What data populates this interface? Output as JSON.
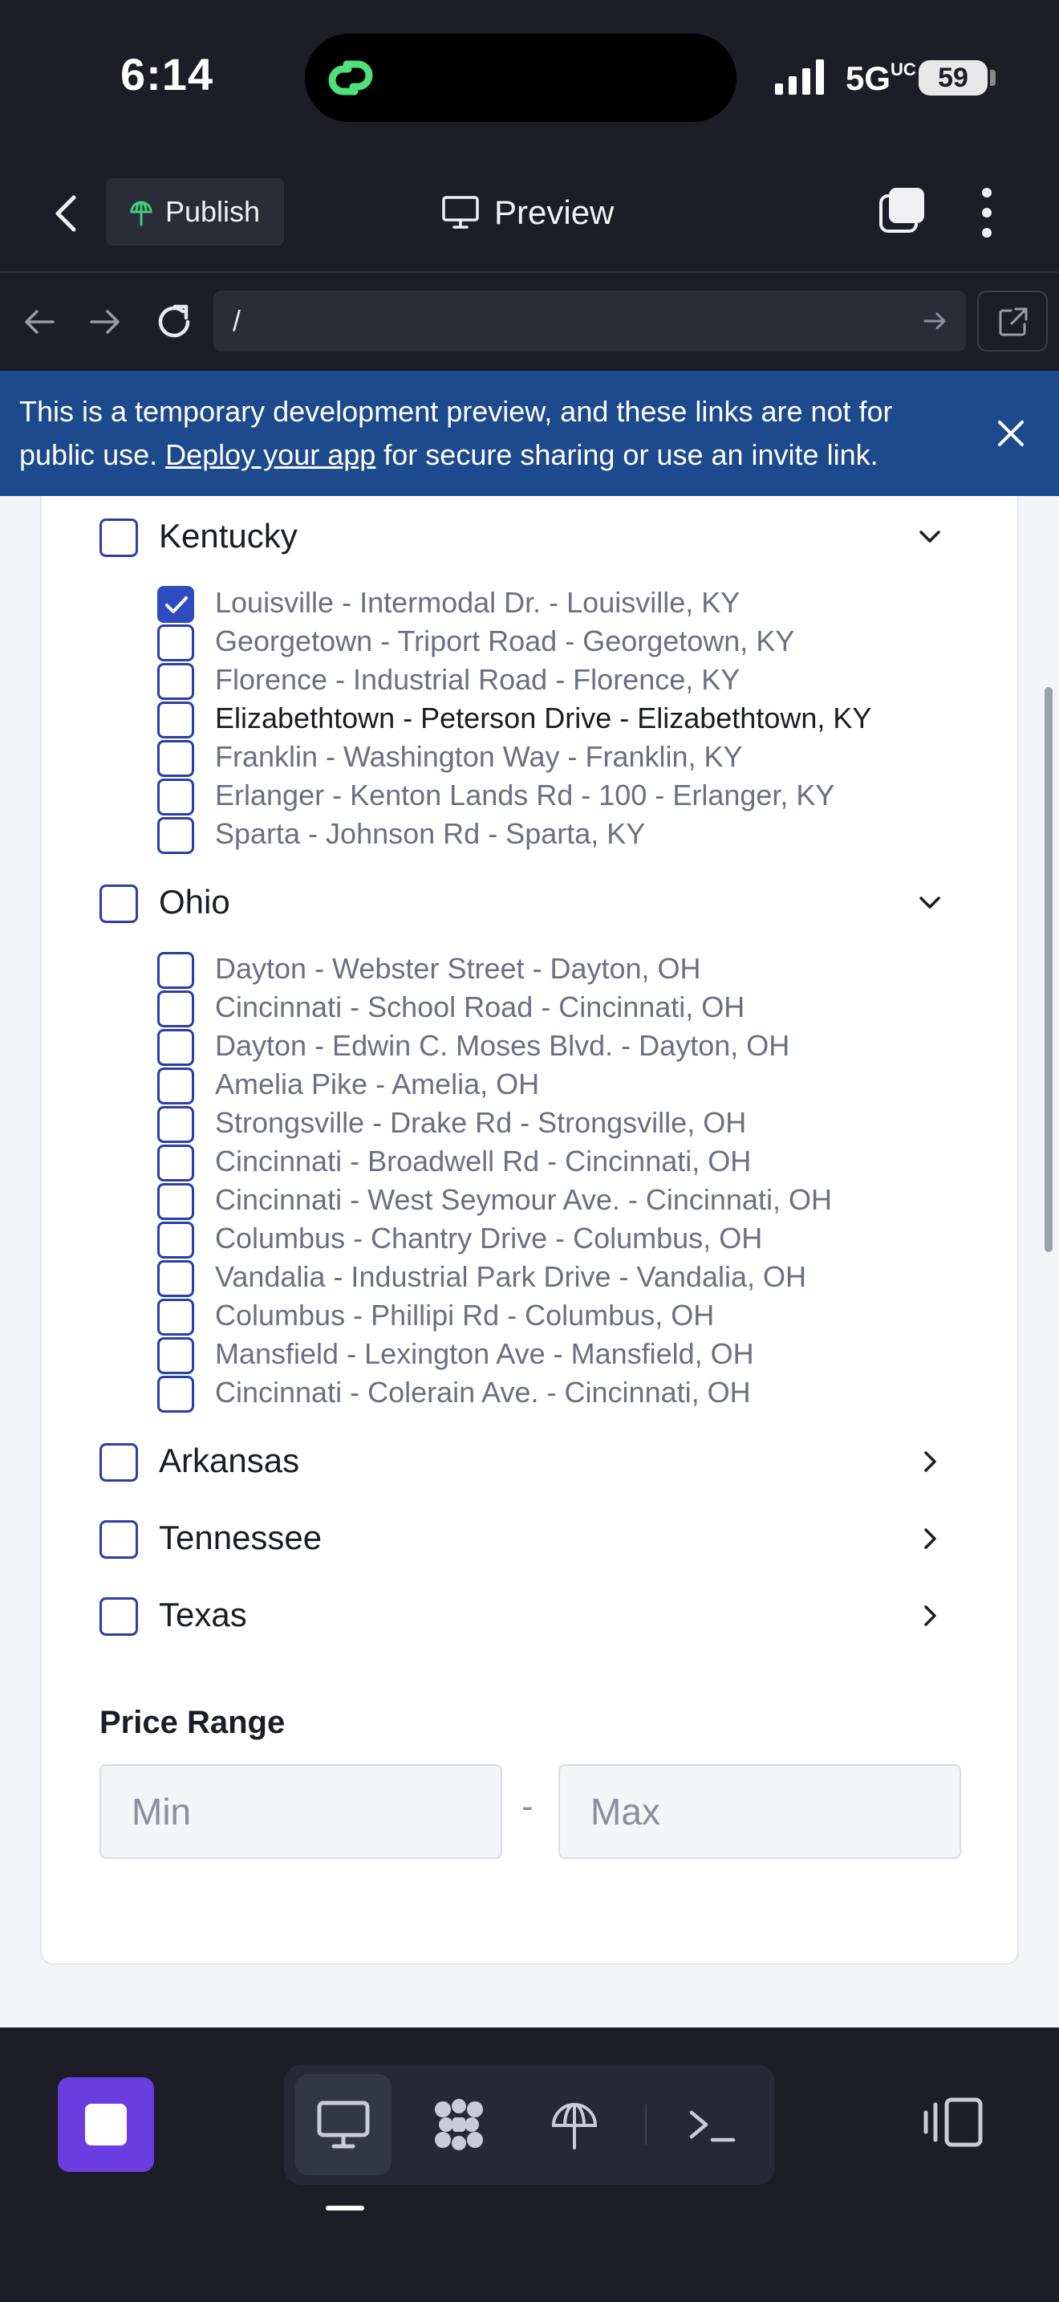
{
  "status_bar": {
    "time": "6:14",
    "network": "5G",
    "network_suffix": "UC",
    "battery": "59"
  },
  "header": {
    "publish_label": "Publish",
    "preview_label": "Preview"
  },
  "url_bar": {
    "value": "/"
  },
  "banner": {
    "text_before": "This is a temporary development preview, and these links are not for public use. ",
    "link_text": "Deploy your app",
    "text_after": " for secure sharing or use an invite link."
  },
  "filters": {
    "states": [
      {
        "name": "Kentucky",
        "expanded": true,
        "checked": false,
        "locations": [
          {
            "label": "Louisville - Intermodal Dr. - Louisville, KY",
            "checked": true
          },
          {
            "label": "Georgetown - Triport Road - Georgetown, KY",
            "checked": false
          },
          {
            "label": "Florence - Industrial Road - Florence, KY",
            "checked": false
          },
          {
            "label": "Elizabethtown - Peterson Drive - Elizabethtown, KY",
            "checked": false
          },
          {
            "label": "Franklin - Washington Way - Franklin, KY",
            "checked": false
          },
          {
            "label": "Erlanger - Kenton Lands Rd - 100 - Erlanger, KY",
            "checked": false
          },
          {
            "label": "Sparta - Johnson Rd - Sparta, KY",
            "checked": false
          }
        ]
      },
      {
        "name": "Ohio",
        "expanded": true,
        "checked": false,
        "locations": [
          {
            "label": "Dayton - Webster Street - Dayton, OH",
            "checked": false
          },
          {
            "label": "Cincinnati - School Road - Cincinnati, OH",
            "checked": false
          },
          {
            "label": "Dayton - Edwin C. Moses Blvd. - Dayton, OH",
            "checked": false
          },
          {
            "label": "Amelia Pike - Amelia, OH",
            "checked": false
          },
          {
            "label": "Strongsville - Drake Rd - Strongsville, OH",
            "checked": false
          },
          {
            "label": "Cincinnati - Broadwell Rd - Cincinnati, OH",
            "checked": false
          },
          {
            "label": "Cincinnati - West Seymour Ave. - Cincinnati, OH",
            "checked": false
          },
          {
            "label": "Columbus - Chantry Drive - Columbus, OH",
            "checked": false
          },
          {
            "label": "Vandalia - Industrial Park Drive - Vandalia, OH",
            "checked": false
          },
          {
            "label": "Columbus - Phillipi Rd - Columbus, OH",
            "checked": false
          },
          {
            "label": "Mansfield - Lexington Ave - Mansfield, OH",
            "checked": false
          },
          {
            "label": "Cincinnati - Colerain Ave. - Cincinnati, OH",
            "checked": false
          }
        ]
      },
      {
        "name": "Arkansas",
        "expanded": false,
        "checked": false
      },
      {
        "name": "Tennessee",
        "expanded": false,
        "checked": false
      },
      {
        "name": "Texas",
        "expanded": false,
        "checked": false
      }
    ],
    "price_range": {
      "title": "Price Range",
      "min_placeholder": "Min",
      "max_placeholder": "Max",
      "separator": "-"
    }
  },
  "colors": {
    "accent": "#2e4bc0",
    "banner": "#1c4a8c",
    "stop_button": "#6a3de0",
    "chrome_bg": "#1c1d26"
  },
  "icons": {
    "header": [
      "back-arrow-icon",
      "publish-icon",
      "monitor-icon",
      "tabs-icon",
      "more-vertical-icon"
    ],
    "url_bar": [
      "nav-back-icon",
      "nav-forward-icon",
      "reload-icon",
      "url-go-icon",
      "open-external-icon"
    ],
    "toolbar": [
      "stop-icon",
      "desktop-icon",
      "workspace-icon",
      "publish-icon",
      "terminal-icon",
      "layout-toggle-icon"
    ]
  }
}
